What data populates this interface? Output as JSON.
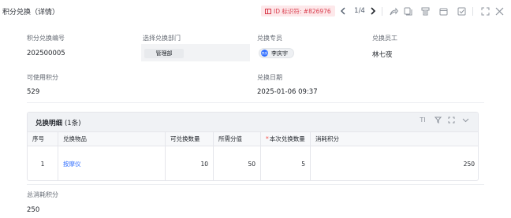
{
  "header": {
    "title": "积分兑换（详情）",
    "id_tag": "ID 标识符: #826976",
    "pagination": "1/4"
  },
  "form": {
    "exchange_no": {
      "label": "积分兑换编号",
      "value": "202500005"
    },
    "department": {
      "label": "选择兑换部门",
      "value": "管理部"
    },
    "exchanger": {
      "label": "兑换专员",
      "value": "李庆宇",
      "avatar_text": "李庆"
    },
    "employee": {
      "label": "兑换员工",
      "value": "林七夜"
    },
    "available_points": {
      "label": "可使用积分",
      "value": "529"
    },
    "exchange_date": {
      "label": "兑换日期",
      "value": "2025-01-06 09:37"
    },
    "total_points": {
      "label": "总消耗积分",
      "value": "250"
    }
  },
  "detail": {
    "title": "兑换明细",
    "count": "(1条)",
    "columns": [
      "序号",
      "兑换物品",
      "可兑换数量",
      "所需分值",
      "本次兑换数量",
      "消耗积分"
    ],
    "rows": [
      {
        "index": "1",
        "item": "按摩仪",
        "available_qty": "10",
        "points_required": "50",
        "exchange_qty": "5",
        "points_consumed": "250"
      }
    ]
  },
  "icons": {
    "prev": "chevron-left-icon",
    "next": "chevron-right-icon",
    "share": "share-icon",
    "copy": "copy-icon",
    "print": "print-icon",
    "calendar": "calendar-icon",
    "check": "check-square-icon",
    "fullscreen": "fullscreen-icon",
    "close": "close-icon"
  },
  "colors": {
    "accent": "#3370ff",
    "tag_text": "#d83a4a",
    "tag_bg": "#fde8ea",
    "required": "#f54a45"
  }
}
